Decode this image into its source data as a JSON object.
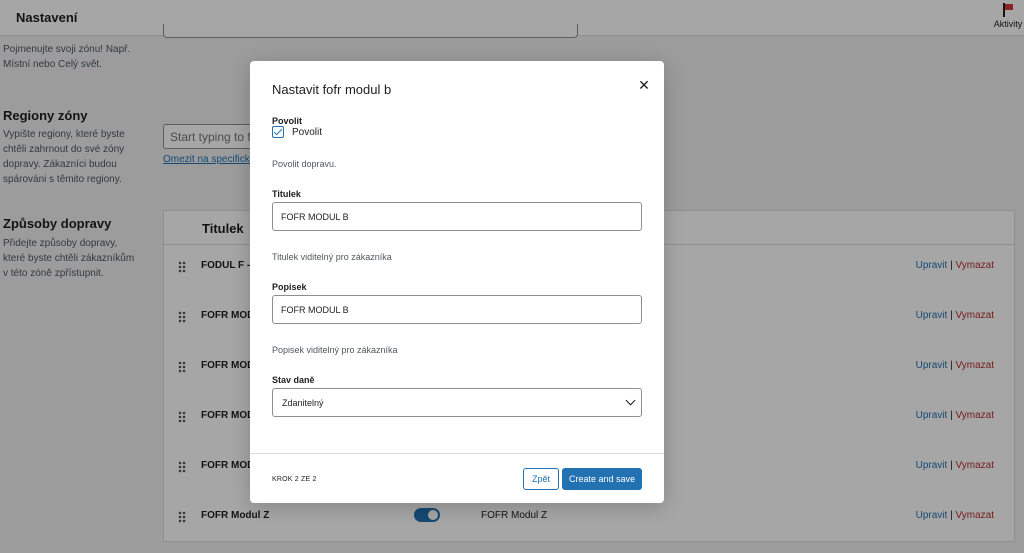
{
  "topbar": {
    "title": "Nastavení",
    "activity_label": "Aktivity",
    "activity_icon": "flag-icon"
  },
  "zone_name_section": {
    "description": "Pojmenujte svoji zónu! Např. Místní nebo Celý svět."
  },
  "regions_section": {
    "title": "Regiony zóny",
    "description": "Vypište regiony, které byste chtěli zahrnout do své zóny dopravy. Zákazníci budou spárováni s těmito regiony.",
    "input_placeholder": "Start typing to filter",
    "limit_link": "Omezit na specifická PSČ"
  },
  "methods_section": {
    "title": "Způsoby dopravy",
    "description": "Přidejte způsoby dopravy, které byste chtěli zákazníkům v této zóně zpřístupnit.",
    "column_title": "Titulek",
    "edit_label": "Upravit",
    "separator": "|",
    "delete_label": "Vymazat",
    "rows": [
      {
        "name": "FODUL F --",
        "description": ""
      },
      {
        "name": "FOFR MODUL",
        "description": ""
      },
      {
        "name": "FOFR MOD",
        "description": ""
      },
      {
        "name": "FOFR MOD",
        "description": ""
      },
      {
        "name": "FOFR MOD",
        "description": ""
      },
      {
        "name": "FOFR Modul Z",
        "description": "FOFR Modul Z"
      }
    ]
  },
  "modal": {
    "title": "Nastavit fofr modul b",
    "close_icon": "close-icon",
    "enable": {
      "label": "Povolit",
      "checkbox_label": "Povolit",
      "checked": true,
      "help": "Povolit dopravu."
    },
    "title_field": {
      "label": "Titulek",
      "value": "FOFR MODUL B",
      "help": "Titulek viditelný pro zákazníka"
    },
    "description_field": {
      "label": "Popisek",
      "value": "FOFR MODUL B",
      "help": "Popisek viditelný pro zákazníka"
    },
    "tax_status": {
      "label": "Stav daně",
      "selected": "Zdanitelný"
    },
    "footer": {
      "step": "KROK 2 ZE 2",
      "back_label": "Zpět",
      "save_label": "Create and save"
    }
  },
  "colors": {
    "accent": "#2271b1",
    "delete": "#b32d2e",
    "overlay": "rgba(0,0,0,0.35)"
  }
}
